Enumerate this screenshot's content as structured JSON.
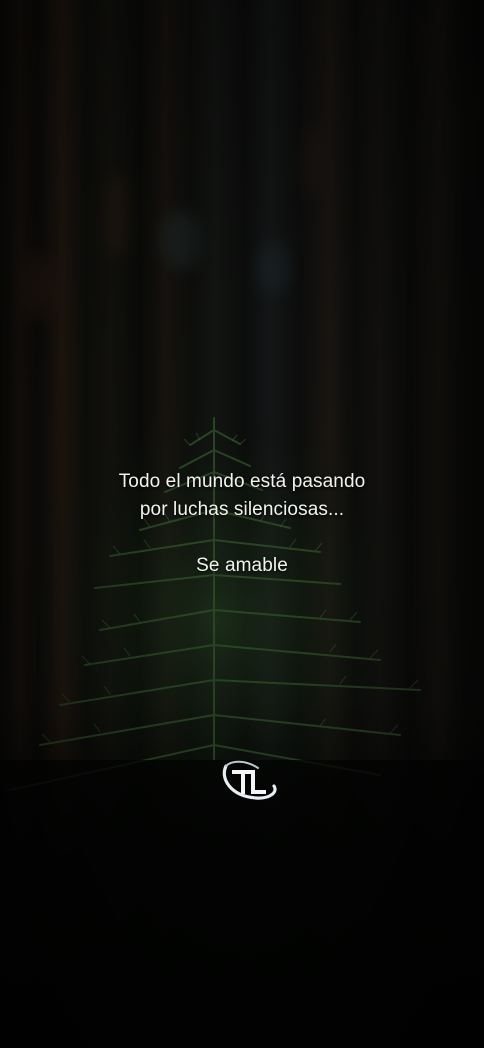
{
  "quote": {
    "line1": "Todo el mundo está pasando",
    "line2": "por luchas silenciosas...",
    "line3": "Se amable"
  },
  "logo": {
    "icon": "tl-monogram-logo",
    "text": "TL"
  },
  "colors": {
    "text": "#f2f2ee",
    "foliage": "#1f3a1c",
    "background": "#0b0b09"
  }
}
